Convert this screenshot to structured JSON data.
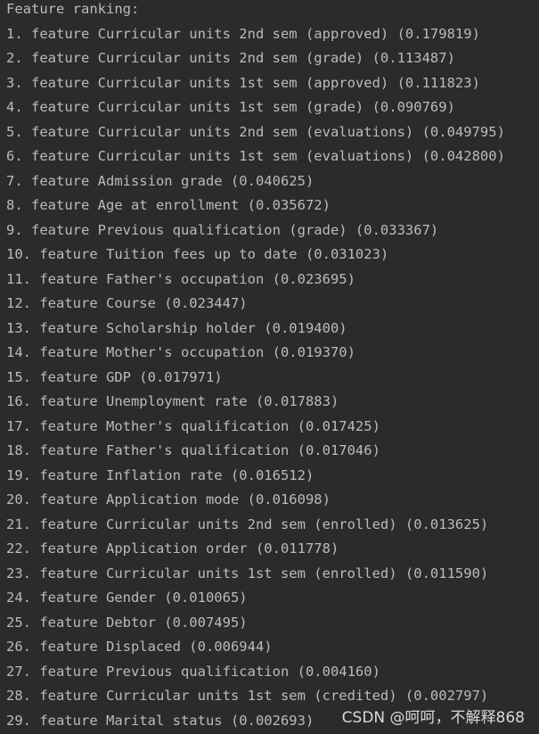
{
  "console": {
    "header": "Feature ranking:",
    "lines": [
      "1. feature Curricular units 2nd sem (approved) (0.179819)",
      "2. feature Curricular units 2nd sem (grade) (0.113487)",
      "3. feature Curricular units 1st sem (approved) (0.111823)",
      "4. feature Curricular units 1st sem (grade) (0.090769)",
      "5. feature Curricular units 2nd sem (evaluations) (0.049795)",
      "6. feature Curricular units 1st sem (evaluations) (0.042800)",
      "7. feature Admission grade (0.040625)",
      "8. feature Age at enrollment (0.035672)",
      "9. feature Previous qualification (grade) (0.033367)",
      "10. feature Tuition fees up to date (0.031023)",
      "11. feature Father's occupation (0.023695)",
      "12. feature Course (0.023447)",
      "13. feature Scholarship holder (0.019400)",
      "14. feature Mother's occupation (0.019370)",
      "15. feature GDP (0.017971)",
      "16. feature Unemployment rate (0.017883)",
      "17. feature Mother's qualification (0.017425)",
      "18. feature Father's qualification (0.017046)",
      "19. feature Inflation rate (0.016512)",
      "20. feature Application mode (0.016098)",
      "21. feature Curricular units 2nd sem (enrolled) (0.013625)",
      "22. feature Application order (0.011778)",
      "23. feature Curricular units 1st sem (enrolled) (0.011590)",
      "24. feature Gender (0.010065)",
      "25. feature Debtor (0.007495)",
      "26. feature Displaced (0.006944)",
      "27. feature Previous qualification (0.004160)",
      "28. feature Curricular units 1st sem (credited) (0.002797)",
      "29. feature Marital status (0.002693)"
    ]
  },
  "watermark": "CSDN @呵呵，不解释868",
  "colors": {
    "background": "#2b2b2b",
    "text": "#bbbbbb"
  }
}
